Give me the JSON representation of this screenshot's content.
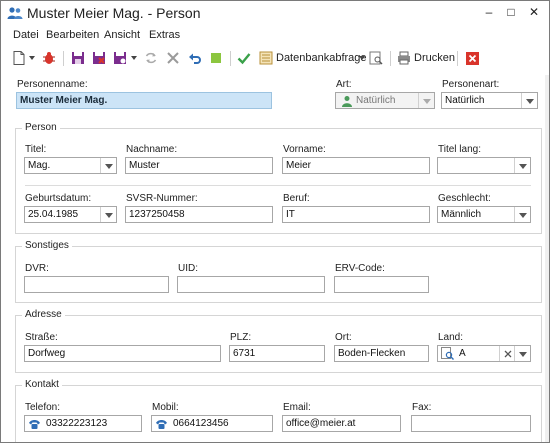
{
  "window": {
    "title": "Muster Meier Mag. - Person",
    "controls": [
      "–",
      "□",
      "✕"
    ]
  },
  "menu": [
    "Datei",
    "Bearbeiten",
    "Ansicht",
    "Extras"
  ],
  "toolbar": {
    "query_label": "Datenbankabfrage",
    "print_label": "Drucken"
  },
  "header": {
    "personenname_label": "Personenname:",
    "personenname_value": "Muster Meier Mag.",
    "art_label": "Art:",
    "art_value": "Natürlich",
    "personenart_label": "Personenart:",
    "personenart_value": "Natürlich"
  },
  "person": {
    "group_title": "Person",
    "titel_label": "Titel:",
    "titel_value": "Mag.",
    "nachname_label": "Nachname:",
    "nachname_value": "Muster",
    "vorname_label": "Vorname:",
    "vorname_value": "Meier",
    "titel_lang_label": "Titel lang:",
    "titel_lang_value": "",
    "geburtsdatum_label": "Geburtsdatum:",
    "geburtsdatum_value": "25.04.1985",
    "svsr_label": "SVSR-Nummer:",
    "svsr_value": "1237250458",
    "beruf_label": "Beruf:",
    "beruf_value": "IT",
    "geschlecht_label": "Geschlecht:",
    "geschlecht_value": "Männlich"
  },
  "sonstiges": {
    "group_title": "Sonstiges",
    "dvr_label": "DVR:",
    "dvr_value": "",
    "uid_label": "UID:",
    "uid_value": "",
    "erv_label": "ERV-Code:",
    "erv_value": ""
  },
  "adresse": {
    "group_title": "Adresse",
    "strasse_label": "Straße:",
    "strasse_value": "Dorfweg",
    "plz_label": "PLZ:",
    "plz_value": "6731",
    "ort_label": "Ort:",
    "ort_value": "Boden-Flecken",
    "land_label": "Land:",
    "land_value": "A"
  },
  "kontakt": {
    "group_title": "Kontakt",
    "telefon_label": "Telefon:",
    "telefon_value": "03322223123",
    "mobil_label": "Mobil:",
    "mobil_value": "0664123456",
    "email_label": "Email:",
    "email_value": "office@meier.at",
    "fax_label": "Fax:",
    "fax_value": ""
  },
  "colors": {
    "highlight_field": "#cce4f7",
    "accent_blue": "#2f6db5",
    "toolbar_purple": "#7b2d8e",
    "delete_red": "#d9342b",
    "check_green": "#3aa14a"
  },
  "icons": [
    "people-icon",
    "new-document-icon",
    "bug-icon",
    "save-icon",
    "save-close-icon",
    "save-copy-icon",
    "refresh-icon",
    "delete-x-icon",
    "undo-icon",
    "stop-icon",
    "check-icon",
    "database-query-icon",
    "preview-icon",
    "print-icon",
    "close-red-icon",
    "person-icon",
    "phone-icon",
    "search-icon"
  ]
}
